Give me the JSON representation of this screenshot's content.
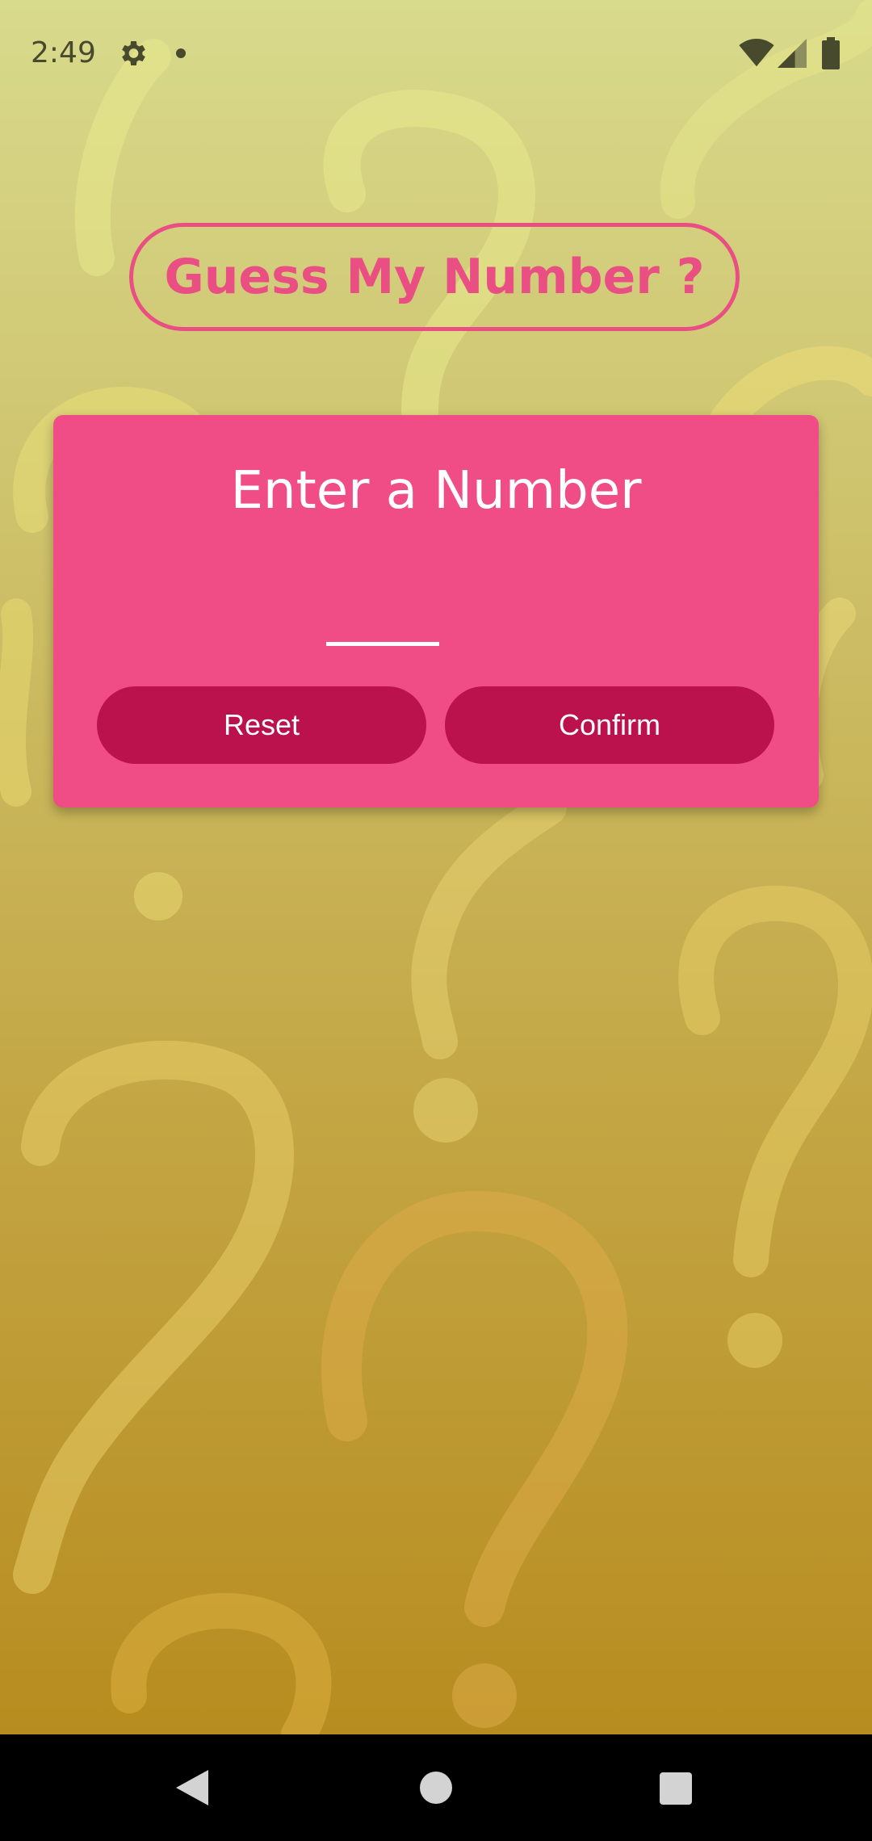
{
  "status_bar": {
    "time": "2:49",
    "icons": [
      "gear-icon",
      "notification-dot-icon",
      "wifi-icon",
      "signal-icon",
      "battery-icon"
    ]
  },
  "app": {
    "title": "Guess My Number ?"
  },
  "card": {
    "title": "Enter a Number",
    "input": {
      "value": "",
      "placeholder": ""
    },
    "reset_label": "Reset",
    "confirm_label": "Confirm"
  },
  "nav_bar": {
    "icons": [
      "back-icon",
      "home-icon",
      "recents-icon"
    ]
  },
  "colors": {
    "accent": "#ea4f84",
    "card_background": "#f04d86",
    "button_background": "#bb114c",
    "background_top": "#d8da8c",
    "background_bottom": "#b78c1f"
  }
}
